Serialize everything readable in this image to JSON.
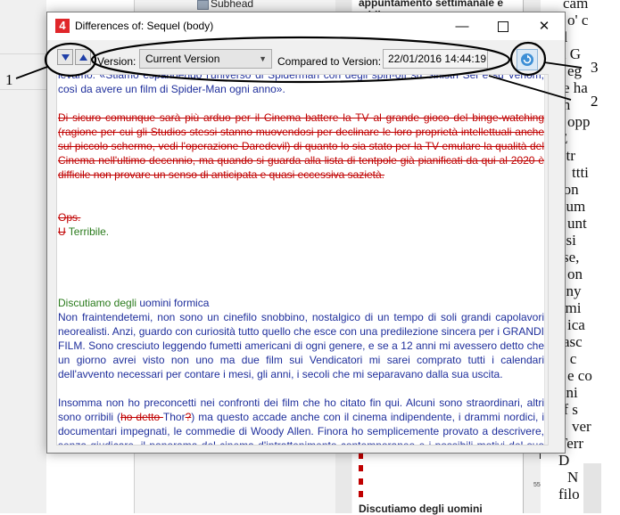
{
  "background": {
    "subhead_label": "Subhead",
    "doc_heading": "appuntamento settimanale e addittura",
    "doc_bottom_heading": "Discutiamo degli uomini",
    "ruler_number": "5540",
    "right_doc_fragments": [
      "cam",
      "o' c",
      "Il",
      "n G",
      "eg",
      "e ha",
      "in",
      "opp",
      "E",
      "otr",
      "ttti",
      "ron",
      "num",
      "unt",
      "osi",
      "se,",
      "on",
      "ony",
      "ami",
      "ica",
      "asc",
      "o c",
      "e co",
      "uni",
      "ff s",
      "ver",
      "Terr",
      "D",
      "N",
      "filo"
    ]
  },
  "dialog": {
    "app_icon": "4",
    "title": "Differences of: Sequel (body)",
    "window_controls": {
      "minimize": "—",
      "close": "✕"
    },
    "toolbar": {
      "next_button_icon": "arrow-down-icon",
      "prev_button_icon": "arrow-up-icon",
      "version_label": "Version:",
      "version_value": "Current Version",
      "compared_label": "Compared to Version:",
      "compared_value": "22/01/2016 14:44:19",
      "refresh_icon": "refresh-icon"
    },
    "content": {
      "para1": "levamo: «Stiamo espandendo l'universo di Spiderman con degli spin-off su Sinistri Sei e su Venom, così da avere un film di Spider-Man ogni anno».",
      "para2_deleted": "Di sicuro comunque sarà più arduo per il Cinema battere la TV al grande gioco del binge-watching (ragione per cui gli Studios stessi stanno muovendosi per declinare le loro proprietà intellettuali anche sul piccolo schermo, vedi l'operazione Daredevil) di quanto lo sia stato per la TV emulare la qualità del Cinema nell'ultimo decennio, ma quando si guarda alla lista di tentpole già pianificati da qui al 2020 è difficile non provare un senso di anticipata e quasi eccessiva sazietà.",
      "ops_deleted": "Ops.",
      "terribile_deleted_letter": "U",
      "terribile_inserted": " Terribile.",
      "heading_inserted": "Discutiamo degli ",
      "heading_rest": "uomini formica",
      "para3": "Non fraintendetemi, non sono un cinefilo snobbino, nostalgico di un tempo di soli grandi capolavori neorealisti. Anzi, guardo con curiosità tutto quello che esce con una predilezione sincera per i GRANDI FILM. Sono cresciuto leggendo fumetti americani di ogni genere, e se a 12 anni mi avessero detto che un giorno avrei visto non uno ma due film sui Vendicatori mi sarei comprato tutti i calendari dell'avvento necessari per contare i mesi, gli anni, i secoli che mi separavano dalla sua uscita.",
      "para4_start": "Insomma non ho preconcetti nei confronti dei film che ho citato fin qui. Alcuni sono straordinari, altri sono orribili (",
      "para4_deleted": "ho detto ",
      "para4_thor": "Thor",
      "para4_thor_deleted": "?",
      "para4_end": ") ma questo accade anche con il cinema indipendente, i drammi nordici, i documentari impegnati, le commedie di Woody Allen. Finora ho semplicemente provato a descrivere, senza giudicare, il panorama del cinema d'intrattenimento contemporaneo e i possibili motivi del suo successo."
    }
  },
  "annotations": {
    "label_1": "1",
    "label_2": "2",
    "label_3": "3"
  },
  "colors": {
    "deleted": "#c00000",
    "inserted": "#2a7b1c",
    "unchanged": "#1f2f9c",
    "accent_icon": "#e0262a"
  }
}
